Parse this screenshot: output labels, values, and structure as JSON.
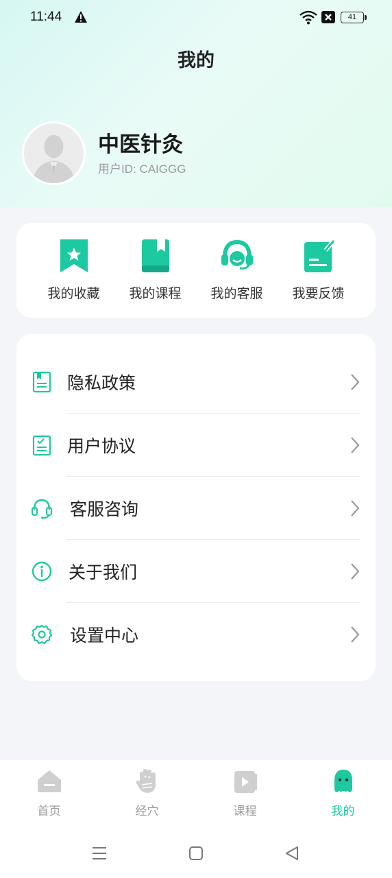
{
  "status_bar": {
    "time": "11:44",
    "battery": "41",
    "icons": [
      "warning-icon",
      "wifi-icon",
      "x-icon",
      "battery-icon"
    ]
  },
  "header": {
    "title": "我的"
  },
  "profile": {
    "name": "中医针灸",
    "user_id": "用户ID: CAIGGG"
  },
  "quick_actions": [
    {
      "label": "我的收藏",
      "icon": "bookmark-star-icon"
    },
    {
      "label": "我的课程",
      "icon": "book-icon"
    },
    {
      "label": "我的客服",
      "icon": "headset-icon"
    },
    {
      "label": "我要反馈",
      "icon": "edit-note-icon"
    }
  ],
  "menu": [
    {
      "label": "隐私政策",
      "icon": "privacy-doc-icon"
    },
    {
      "label": "用户协议",
      "icon": "agreement-clipboard-icon"
    },
    {
      "label": "客服咨询",
      "icon": "headphones-icon"
    },
    {
      "label": "关于我们",
      "icon": "info-icon"
    },
    {
      "label": "设置中心",
      "icon": "settings-gear-icon"
    }
  ],
  "tabbar": [
    {
      "label": "首页",
      "icon": "home-icon",
      "active": false
    },
    {
      "label": "经穴",
      "icon": "acupoint-hand-icon",
      "active": false
    },
    {
      "label": "课程",
      "icon": "video-icon",
      "active": false
    },
    {
      "label": "我的",
      "icon": "mine-face-icon",
      "active": true
    }
  ],
  "colors": {
    "accent": "#1dc9a0",
    "inactive": "#c4c4c4",
    "background": "#f3f5f9"
  }
}
